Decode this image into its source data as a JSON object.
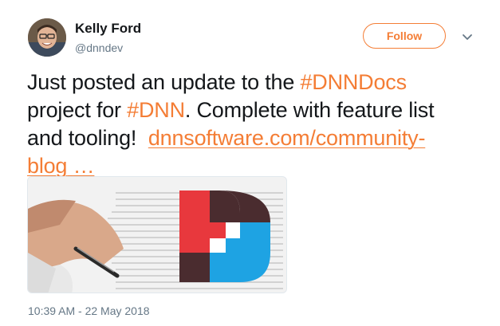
{
  "author": {
    "name": "Kelly Ford",
    "handle": "@dnndev",
    "avatar_icon": "profile-photo"
  },
  "actions": {
    "follow_label": "Follow",
    "more_icon": "chevron-down-icon"
  },
  "tweet": {
    "text_part1": "Just posted an update to the ",
    "hashtag1": "#DNNDocs",
    "text_part2": " project for ",
    "hashtag2": "#DNN",
    "text_part3": ". Complete with feature list and tooling!",
    "link_text": "dnnsoftware.com/community-blog",
    "link_ellipsis": "…"
  },
  "media": {
    "icon": "dnn-logo"
  },
  "timestamp": "10:39 AM - 22 May 2018",
  "colors": {
    "accent": "#f47d35",
    "text": "#14171a",
    "muted": "#657786",
    "dnn_red": "#e8383d",
    "dnn_dark": "#4a2c2f",
    "dnn_blue": "#1ea3e3"
  }
}
